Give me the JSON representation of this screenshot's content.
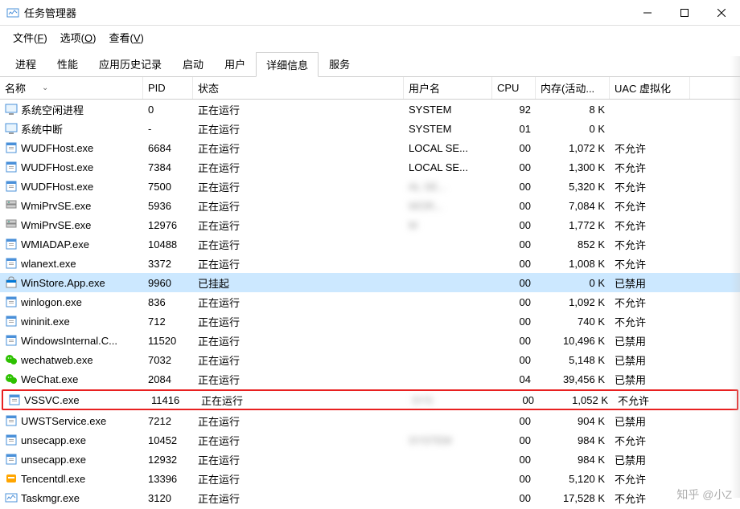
{
  "window": {
    "title": "任务管理器"
  },
  "menu": {
    "file": "文件",
    "file_key": "F",
    "options": "选项",
    "options_key": "O",
    "view": "查看",
    "view_key": "V"
  },
  "tabs": {
    "items": [
      {
        "label": "进程"
      },
      {
        "label": "性能"
      },
      {
        "label": "应用历史记录"
      },
      {
        "label": "启动"
      },
      {
        "label": "用户"
      },
      {
        "label": "详细信息"
      },
      {
        "label": "服务"
      }
    ],
    "active_index": 5
  },
  "columns": {
    "name": "名称",
    "pid": "PID",
    "status": "状态",
    "user": "用户名",
    "cpu": "CPU",
    "mem": "内存(活动...",
    "uac": "UAC 虚拟化"
  },
  "processes": [
    {
      "name": "系统空闲进程",
      "pid": "0",
      "status": "正在运行",
      "user": "SYSTEM",
      "cpu": "92",
      "mem": "8 K",
      "uac": "",
      "icon": "system"
    },
    {
      "name": "系统中断",
      "pid": "-",
      "status": "正在运行",
      "user": "SYSTEM",
      "cpu": "01",
      "mem": "0 K",
      "uac": "",
      "icon": "system"
    },
    {
      "name": "WUDFHost.exe",
      "pid": "6684",
      "status": "正在运行",
      "user": "LOCAL SE...",
      "cpu": "00",
      "mem": "1,072 K",
      "uac": "不允许",
      "icon": "exe"
    },
    {
      "name": "WUDFHost.exe",
      "pid": "7384",
      "status": "正在运行",
      "user": "LOCAL SE...",
      "cpu": "00",
      "mem": "1,300 K",
      "uac": "不允许",
      "icon": "exe"
    },
    {
      "name": "WUDFHost.exe",
      "pid": "7500",
      "status": "正在运行",
      "user": "AL SE...",
      "user_blur": true,
      "cpu": "00",
      "mem": "5,320 K",
      "uac": "不允许",
      "icon": "exe"
    },
    {
      "name": "WmiPrvSE.exe",
      "pid": "5936",
      "status": "正在运行",
      "user": "WOR...",
      "user_blur": true,
      "cpu": "00",
      "mem": "7,084 K",
      "uac": "不允许",
      "icon": "server"
    },
    {
      "name": "WmiPrvSE.exe",
      "pid": "12976",
      "status": "正在运行",
      "user": "M",
      "user_blur": true,
      "cpu": "00",
      "mem": "1,772 K",
      "uac": "不允许",
      "icon": "server"
    },
    {
      "name": "WMIADAP.exe",
      "pid": "10488",
      "status": "正在运行",
      "user": "",
      "user_blur": true,
      "cpu": "00",
      "mem": "852 K",
      "uac": "不允许",
      "icon": "exe"
    },
    {
      "name": "wlanext.exe",
      "pid": "3372",
      "status": "正在运行",
      "user": "",
      "user_blur": true,
      "cpu": "00",
      "mem": "1,008 K",
      "uac": "不允许",
      "icon": "exe"
    },
    {
      "name": "WinStore.App.exe",
      "pid": "9960",
      "status": "已挂起",
      "user": "",
      "user_blur": true,
      "cpu": "00",
      "mem": "0 K",
      "uac": "已禁用",
      "icon": "store",
      "selected": true
    },
    {
      "name": "winlogon.exe",
      "pid": "836",
      "status": "正在运行",
      "user": "",
      "user_blur": true,
      "cpu": "00",
      "mem": "1,092 K",
      "uac": "不允许",
      "icon": "exe"
    },
    {
      "name": "wininit.exe",
      "pid": "712",
      "status": "正在运行",
      "user": "",
      "user_blur": true,
      "cpu": "00",
      "mem": "740 K",
      "uac": "不允许",
      "icon": "exe"
    },
    {
      "name": "WindowsInternal.C...",
      "pid": "11520",
      "status": "正在运行",
      "user": "",
      "user_blur": true,
      "cpu": "00",
      "mem": "10,496 K",
      "uac": "已禁用",
      "icon": "exe"
    },
    {
      "name": "wechatweb.exe",
      "pid": "7032",
      "status": "正在运行",
      "user": "",
      "user_blur": true,
      "cpu": "00",
      "mem": "5,148 K",
      "uac": "已禁用",
      "icon": "wechat"
    },
    {
      "name": "WeChat.exe",
      "pid": "2084",
      "status": "正在运行",
      "user": "",
      "user_blur": true,
      "cpu": "04",
      "mem": "39,456 K",
      "uac": "已禁用",
      "icon": "wechat"
    },
    {
      "name": "VSSVC.exe",
      "pid": "11416",
      "status": "正在运行",
      "user": "SYS",
      "user_blur": true,
      "cpu": "00",
      "mem": "1,052 K",
      "uac": "不允许",
      "icon": "exe",
      "highlighted": true
    },
    {
      "name": "UWSTService.exe",
      "pid": "7212",
      "status": "正在运行",
      "user": "",
      "user_blur": true,
      "cpu": "00",
      "mem": "904 K",
      "uac": "已禁用",
      "icon": "exe"
    },
    {
      "name": "unsecapp.exe",
      "pid": "10452",
      "status": "正在运行",
      "user": "SYSTEM",
      "user_blur": true,
      "cpu": "00",
      "mem": "984 K",
      "uac": "不允许",
      "icon": "exe"
    },
    {
      "name": "unsecapp.exe",
      "pid": "12932",
      "status": "正在运行",
      "user": "",
      "user_blur": true,
      "cpu": "00",
      "mem": "984 K",
      "uac": "已禁用",
      "icon": "exe"
    },
    {
      "name": "Tencentdl.exe",
      "pid": "13396",
      "status": "正在运行",
      "user": "",
      "user_blur": true,
      "cpu": "00",
      "mem": "5,120 K",
      "uac": "不允许",
      "icon": "tencent"
    },
    {
      "name": "Taskmgr.exe",
      "pid": "3120",
      "status": "正在运行",
      "user": "",
      "user_blur": true,
      "cpu": "00",
      "mem": "17,528 K",
      "uac": "不允许",
      "icon": "taskmgr"
    }
  ],
  "watermark": "知乎 @小Z"
}
